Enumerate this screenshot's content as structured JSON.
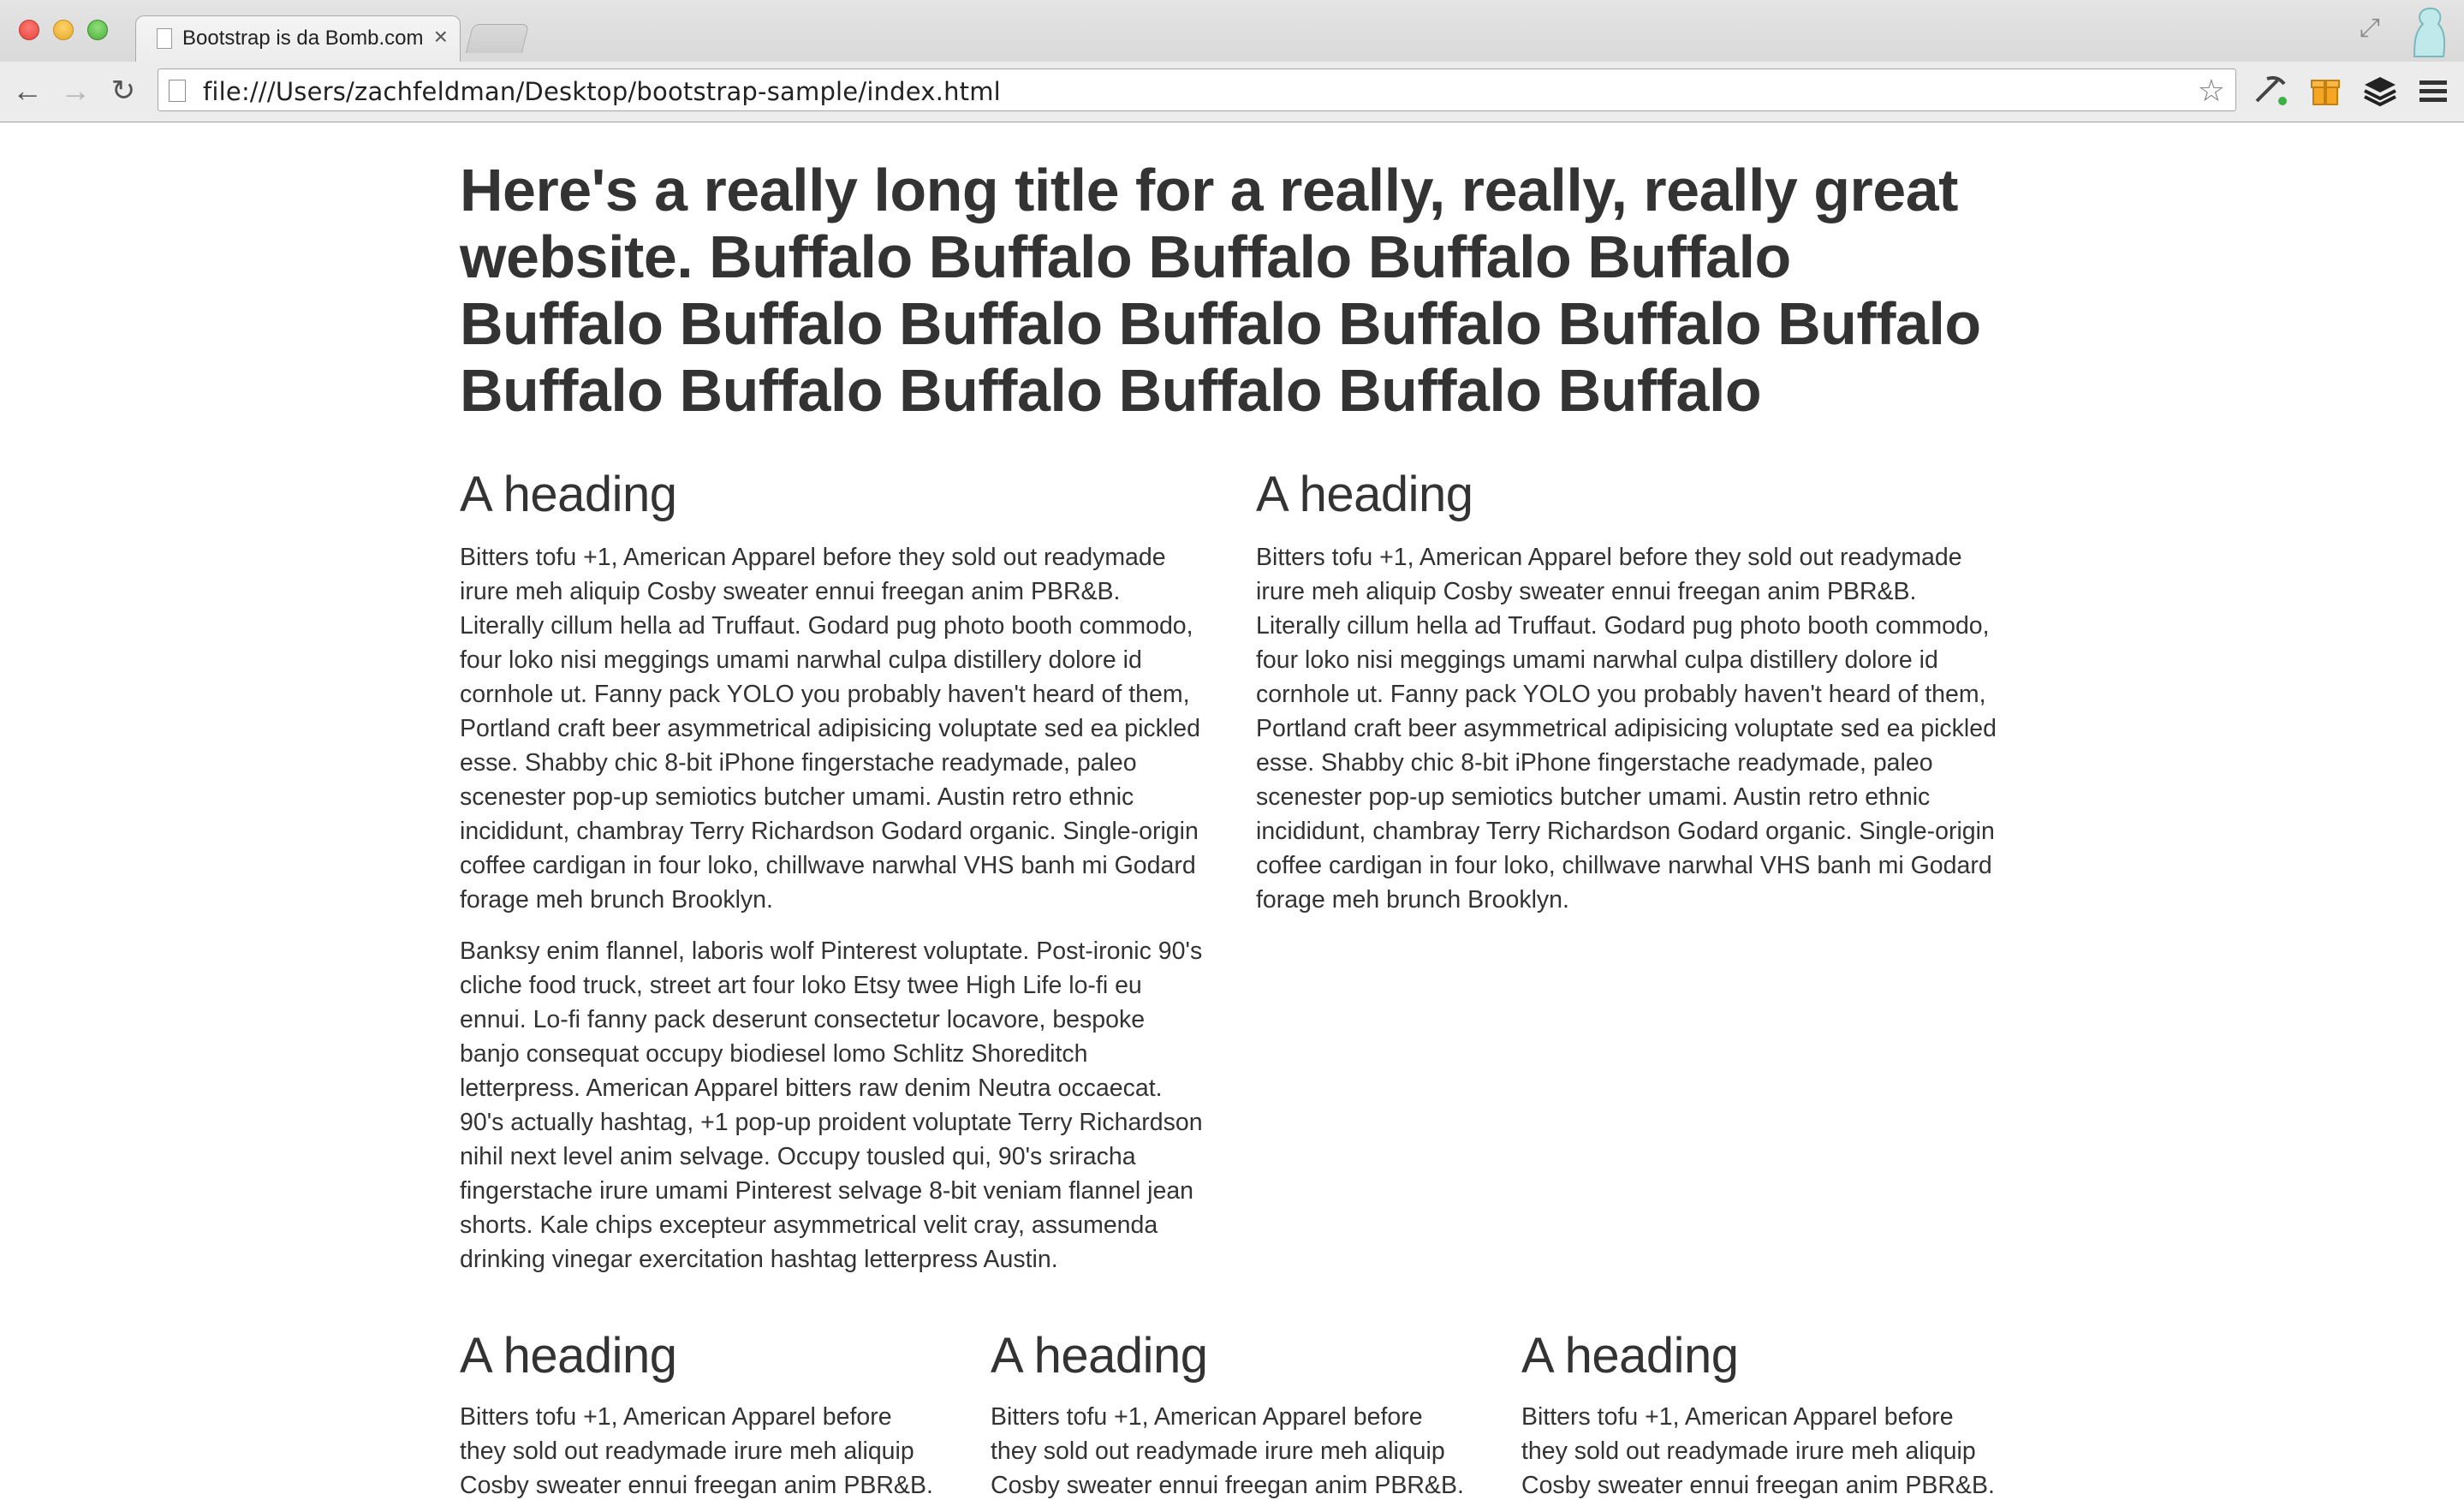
{
  "browser": {
    "tab_title": "Bootstrap is da Bomb.com",
    "tab_close": "×",
    "url": "file:///Users/zachfeldman/Desktop/bootstrap-sample/index.html",
    "icons": {
      "back": "back-arrow-icon",
      "forward": "forward-arrow-icon",
      "reload": "reload-icon",
      "star": "bookmark-star-icon",
      "fullscreen": "fullscreen-icon",
      "menu": "hamburger-menu-icon"
    }
  },
  "page": {
    "title": "Here's a really long title for a really, really, really great website. Buffalo Buffalo Buffalo Buffalo Buffalo Buffalo Buffalo Buffalo Buffalo Buffalo Buffalo Buffalo Buffalo Buffalo Buffalo Buffalo Buffalo Buffalo",
    "row1": [
      {
        "heading": "A heading",
        "paragraphs": [
          "Bitters tofu +1, American Apparel before they sold out readymade irure meh aliquip Cosby sweater ennui freegan anim PBR&B. Literally cillum hella ad Truffaut. Godard pug photo booth commodo, four loko nisi meggings umami narwhal culpa distillery dolore id cornhole ut. Fanny pack YOLO you probably haven't heard of them, Portland craft beer asymmetrical adipisicing voluptate sed ea pickled esse. Shabby chic 8-bit iPhone fingerstache readymade, paleo scenester pop-up semiotics butcher umami. Austin retro ethnic incididunt, chambray Terry Richardson Godard organic. Single-origin coffee cardigan in four loko, chillwave narwhal VHS banh mi Godard forage meh brunch Brooklyn.",
          "Banksy enim flannel, laboris wolf Pinterest voluptate. Post-ironic 90's cliche food truck, street art four loko Etsy twee High Life lo-fi eu ennui. Lo-fi fanny pack deserunt consectetur locavore, bespoke banjo consequat occupy biodiesel lomo Schlitz Shoreditch letterpress. American Apparel bitters raw denim Neutra occaecat. 90's actually hashtag, +1 pop-up proident voluptate Terry Richardson nihil next level anim selvage. Occupy tousled qui, 90's sriracha fingerstache irure umami Pinterest selvage 8-bit veniam flannel jean shorts. Kale chips excepteur asymmetrical velit cray, assumenda drinking vinegar exercitation hashtag letterpress Austin."
        ]
      },
      {
        "heading": "A heading",
        "paragraphs": [
          "Bitters tofu +1, American Apparel before they sold out readymade irure meh aliquip Cosby sweater ennui freegan anim PBR&B. Literally cillum hella ad Truffaut. Godard pug photo booth commodo, four loko nisi meggings umami narwhal culpa distillery dolore id cornhole ut. Fanny pack YOLO you probably haven't heard of them, Portland craft beer asymmetrical adipisicing voluptate sed ea pickled esse. Shabby chic 8-bit iPhone fingerstache readymade, paleo scenester pop-up semiotics butcher umami. Austin retro ethnic incididunt, chambray Terry Richardson Godard organic. Single-origin coffee cardigan in four loko, chillwave narwhal VHS banh mi Godard forage meh brunch Brooklyn."
        ]
      }
    ],
    "row2": [
      {
        "heading": "A heading",
        "paragraph": "Bitters tofu +1, American Apparel before they sold out readymade irure meh aliquip Cosby sweater ennui freegan anim PBR&B."
      },
      {
        "heading": "A heading",
        "paragraph": "Bitters tofu +1, American Apparel before they sold out readymade irure meh aliquip Cosby sweater ennui freegan anim PBR&B."
      },
      {
        "heading": "A heading",
        "paragraph": "Bitters tofu +1, American Apparel before they sold out readymade irure meh aliquip Cosby sweater ennui freegan anim PBR&B."
      }
    ]
  }
}
